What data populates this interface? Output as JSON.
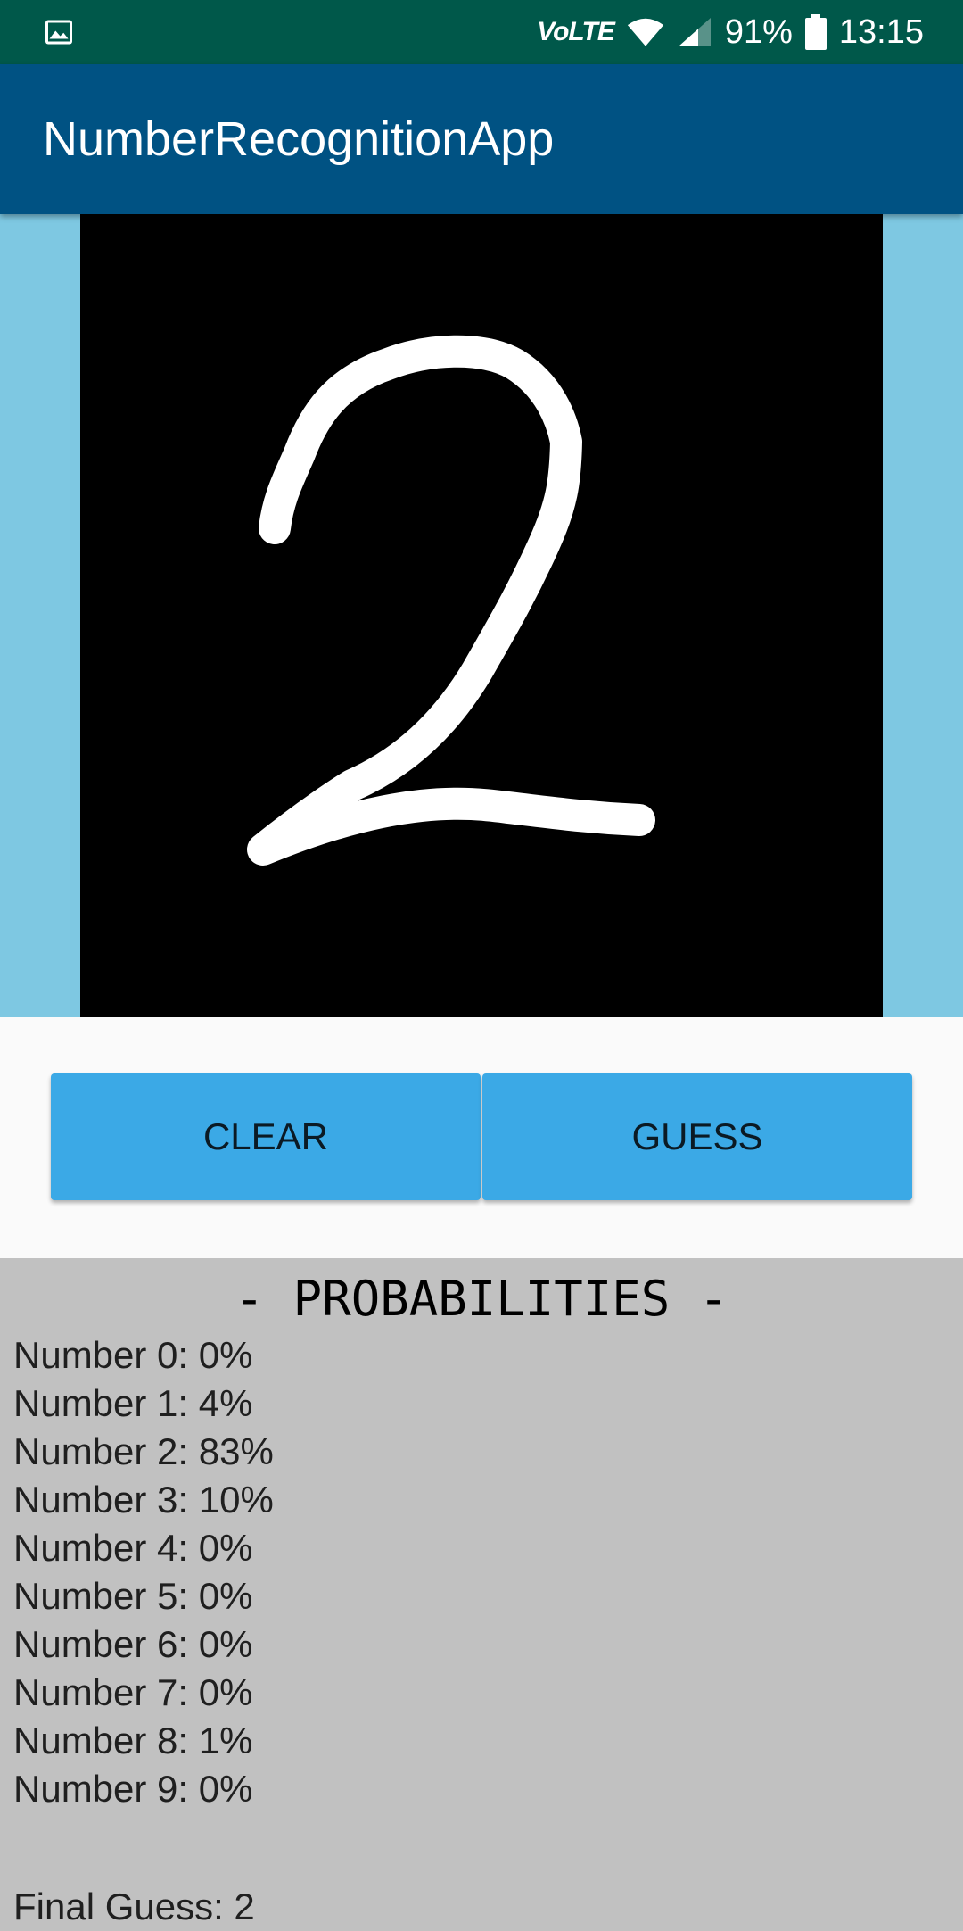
{
  "status_bar": {
    "network": "VoLTE",
    "battery": "91%",
    "time": "13:15"
  },
  "app_bar": {
    "title": "NumberRecognitionApp"
  },
  "canvas": {
    "background_color": "#000000",
    "stroke_color": "#ffffff"
  },
  "buttons": {
    "clear_label": "CLEAR",
    "guess_label": "GUESS"
  },
  "probabilities": {
    "heading": "- PROBABILITIES -",
    "items": [
      "Number 0: 0%",
      "Number 1: 4%",
      "Number 2: 83%",
      "Number 3: 10%",
      "Number 4: 0%",
      "Number 5: 0%",
      "Number 6: 0%",
      "Number 7: 0%",
      "Number 8: 1%",
      "Number 9: 0%"
    ],
    "final_guess": "Final Guess: 2"
  },
  "colors": {
    "status_bar": "#00584a",
    "app_bar": "#005283",
    "canvas_surround": "#7ec8e2",
    "button": "#3ba9e6",
    "probabilities_background": "#c1c1c1"
  }
}
